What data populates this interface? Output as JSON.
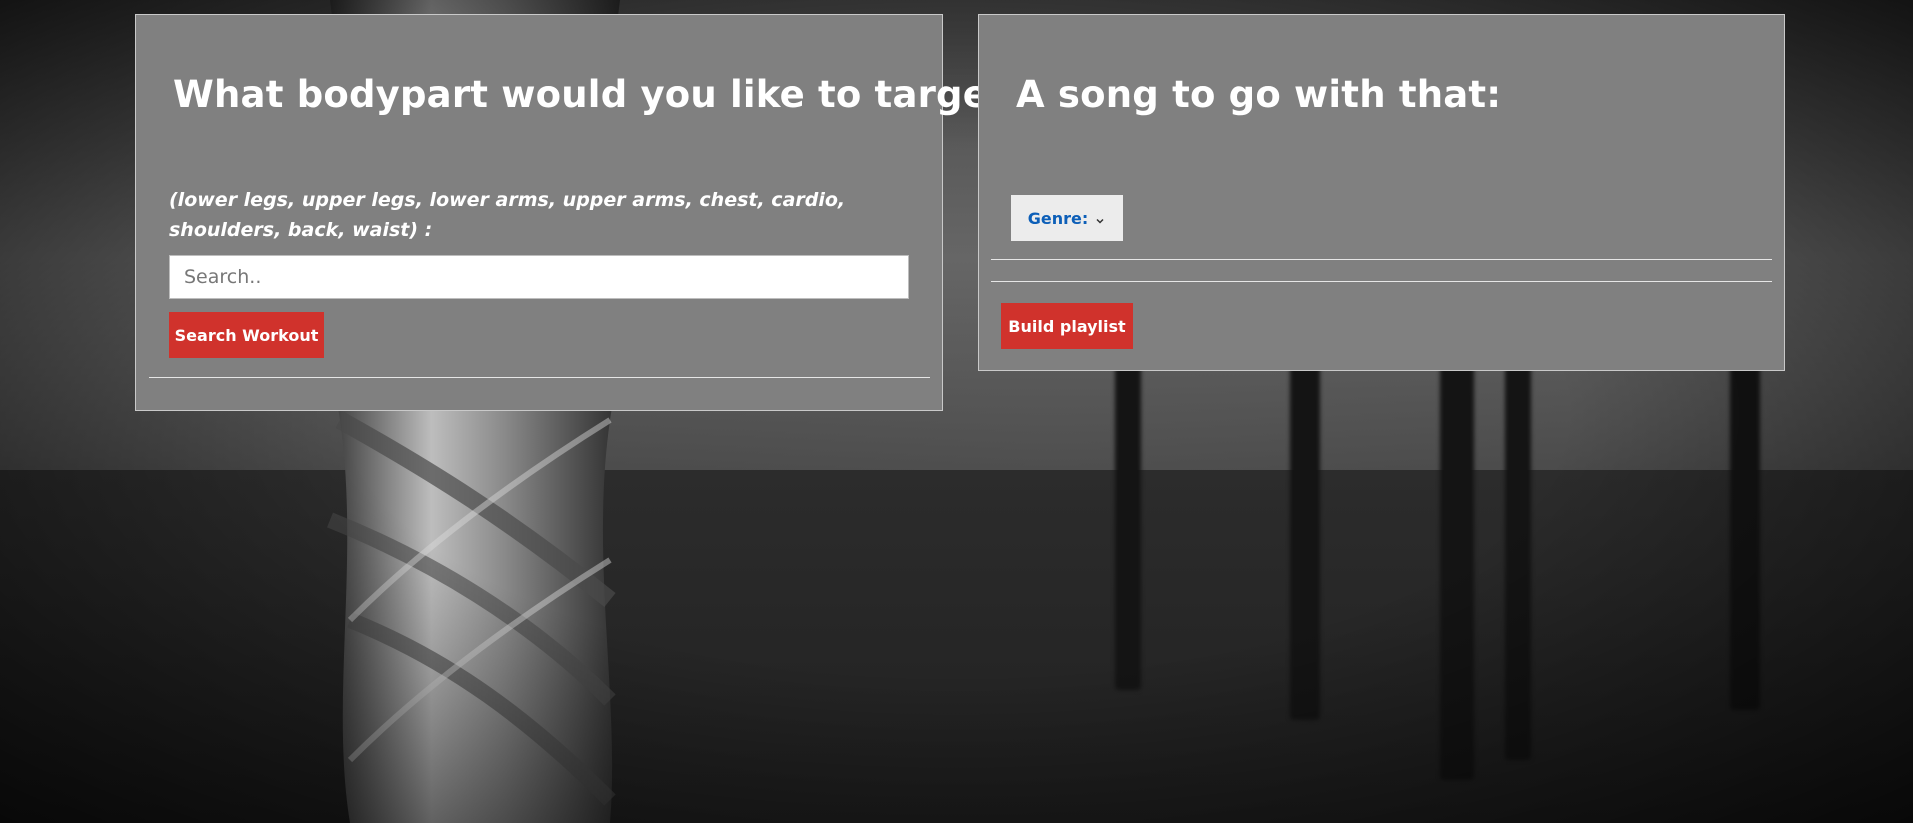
{
  "workout_panel": {
    "title": "What bodypart would you like to target?",
    "hint": "(lower legs, upper legs, lower arms, upper arms, chest, cardio, shoulders, back, waist) :",
    "search_placeholder": "Search..",
    "search_value": "",
    "search_button_label": "Search Workout"
  },
  "song_panel": {
    "title": "A song to go with that:",
    "genre_label": "Genre:",
    "build_button_label": "Build playlist"
  },
  "colors": {
    "panel_bg": "#808080",
    "button_red": "#d0322c",
    "dropdown_text": "#0d5fb8",
    "dropdown_bg": "#ececec"
  },
  "icons": {
    "genre_dropdown": "chevron-down-icon"
  }
}
